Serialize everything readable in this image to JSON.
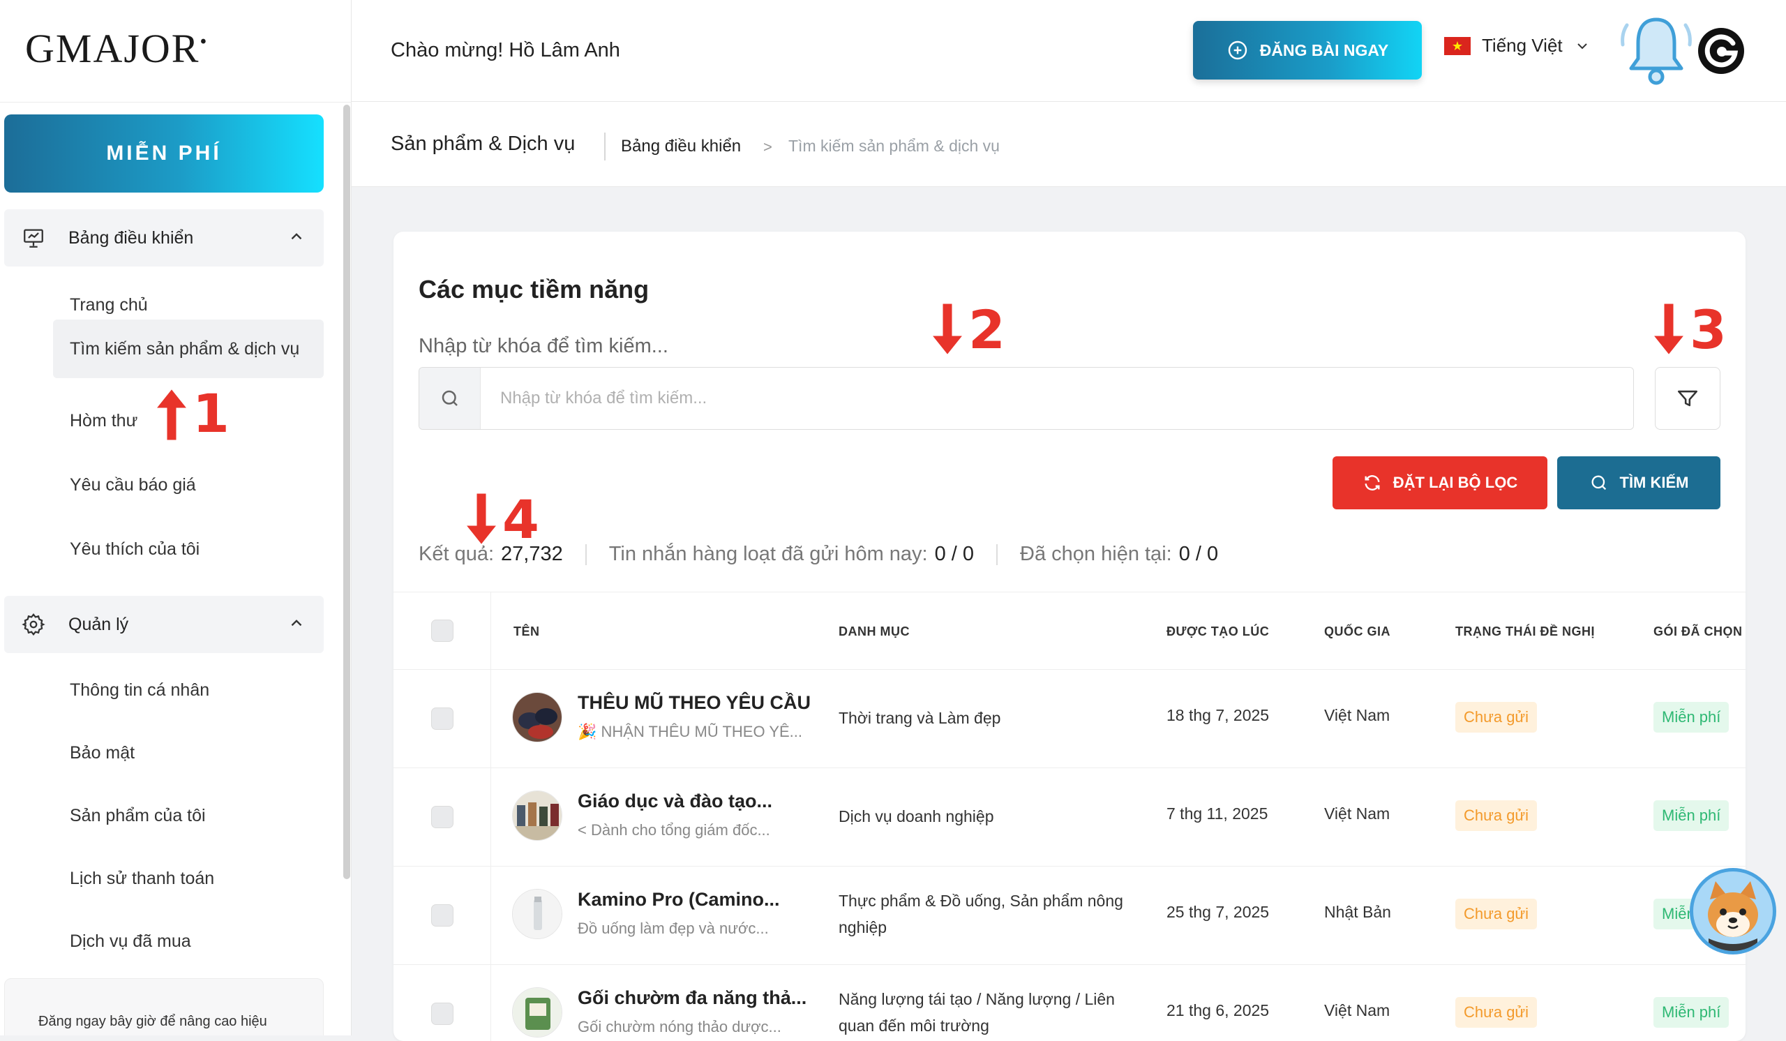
{
  "brand": {
    "logo": "GMAJOR",
    "logo_mark": "•"
  },
  "sidebar": {
    "plan_label": "MIỄN PHÍ",
    "groups": [
      {
        "label": "Bảng điều khiển",
        "icon": "presentation-board-icon",
        "items": [
          "Trang chủ",
          "Tìm kiếm sản phẩm & dịch vụ",
          "Hòm thư",
          "Yêu cầu báo giá",
          "Yêu thích của tôi"
        ]
      },
      {
        "label": "Quản lý",
        "icon": "gear-icon",
        "items": [
          "Thông tin cá nhân",
          "Bảo mật",
          "Sản phẩm của tôi",
          "Lịch sử thanh toán",
          "Dịch vụ đã mua"
        ]
      }
    ],
    "active_item": "Tìm kiếm sản phẩm & dịch vụ",
    "promo_text": "Đăng ngay bây giờ để nâng cao hiệu"
  },
  "header": {
    "welcome": "Chào mừng! Hồ Lâm Anh",
    "post_button": "ĐĂNG BÀI NGAY",
    "language": "Tiếng Việt",
    "flag_icon": "vietnam-flag-icon"
  },
  "breadcrumb": {
    "title": "Sản phẩm & Dịch vụ",
    "home": "Bảng điều khiển",
    "separator": ">",
    "current": "Tìm kiếm sản phẩm & dịch vụ"
  },
  "main": {
    "title": "Các mục tiềm năng",
    "search_label": "Nhập từ khóa để tìm kiếm...",
    "search_placeholder": "Nhập từ khóa để tìm kiếm...",
    "reset_button": "ĐẶT LẠI BỘ LỌC",
    "search_button": "TÌM KIẾM",
    "stats": {
      "results_label": "Kết quả:",
      "results_value": "27,732",
      "bulk_label": "Tin nhắn hàng loạt đã gửi hôm nay:",
      "bulk_value": "0 / 0",
      "selected_label": "Đã chọn hiện tại:",
      "selected_value": "0 / 0"
    },
    "columns": [
      "TÊN",
      "DANH MỤC",
      "ĐƯỢC TẠO LÚC",
      "QUỐC GIA",
      "TRẠNG THÁI ĐỀ NGHỊ",
      "GÓI ĐÃ CHỌN"
    ],
    "rows": [
      {
        "name": "THÊU MŨ THEO YÊU CẦU",
        "sub": "🎉 NHẬN THÊU MŨ THEO YÊ...",
        "category": "Thời trang và Làm đẹp",
        "date": "18 thg 7, 2025",
        "country": "Việt Nam",
        "status": "Chưa gửi",
        "plan": "Miễn phí"
      },
      {
        "name": "Giáo dục và đào tạo...",
        "sub": "< Dành cho tổng giám đốc...",
        "category": "Dịch vụ doanh nghiệp",
        "date": "7 thg 11, 2025",
        "country": "Việt Nam",
        "status": "Chưa gửi",
        "plan": "Miễn phí"
      },
      {
        "name": "Kamino Pro (Camino...",
        "sub": "Đồ uống làm đẹp và nước...",
        "category": "Thực phẩm & Đồ uống, Sản phẩm nông nghiệp",
        "date": "25 thg 7, 2025",
        "country": "Nhật Bản",
        "status": "Chưa gửi",
        "plan": "Miễn"
      },
      {
        "name": "Gối chườm đa năng thả...",
        "sub": "Gối chườm nóng thảo dược...",
        "category": "Năng lượng tái tạo / Năng lượng / Liên quan đến môi trường",
        "date": "21 thg 6, 2025",
        "country": "Việt Nam",
        "status": "Chưa gửi",
        "plan": "Miễn phí"
      }
    ]
  },
  "annotations": [
    "1",
    "2",
    "3",
    "4"
  ],
  "colors": {
    "accent": "#1c6d92",
    "danger": "#e8332a",
    "gradient_start": "#1b6f99",
    "gradient_end": "#12d4f5",
    "pending": "#f39a2b",
    "free": "#2eb873"
  }
}
